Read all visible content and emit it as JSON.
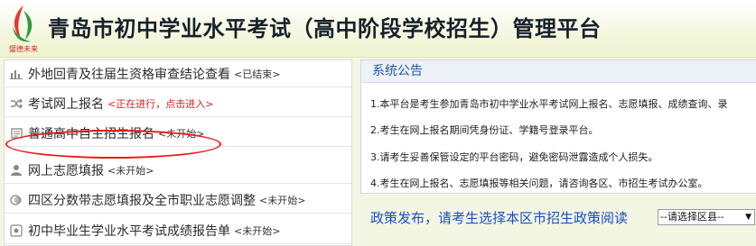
{
  "header": {
    "title": "青岛市初中学业水平考试（高中阶段学校招生）管理平台",
    "logo_text": "璧德未来"
  },
  "menu": [
    {
      "icon": "bar-chart-icon",
      "label": "外地回青及往届生资格审查结论查看",
      "status": "<已结束>",
      "status_color": "#333333"
    },
    {
      "icon": "shuffle-icon",
      "label": "考试网上报名",
      "status": "<正在进行，点击进入>",
      "status_color": "#e02020"
    },
    {
      "icon": "document-icon",
      "label": "普通高中自主招生报名",
      "status": "<未开始>",
      "status_color": "#333333"
    },
    {
      "icon": "user-icon",
      "label": "网上志愿填报",
      "status": "<未开始>",
      "status_color": "#333333"
    },
    {
      "icon": "copy-icon",
      "label": "四区分数带志愿填报及全市职业志愿调整",
      "status": "<未开始>",
      "status_color": "#333333"
    },
    {
      "icon": "report-icon",
      "label": "初中毕业生学业水平考试成绩报告单",
      "status": "<未开始>",
      "status_color": "#333333"
    }
  ],
  "notice": {
    "title": "系统公告",
    "lines": [
      "1.本平台是考生参加青岛市初中学业水平考试网上报名、志愿填报、成绩查询、录",
      "2.考生在网上报名期间凭身份证、学籍号登录平台。",
      "3.请考生妥善保管设定的平台密码，避免密码泄露造成个人损失。",
      "4.考生在网上报名、志愿填报等相关问题，请咨询各区、市招生考试办公室。"
    ]
  },
  "policy": {
    "text": "政策发布，请考生选择本区市招生政策阅读",
    "select_value": "--请选择区县--"
  },
  "colors": {
    "accent_blue": "#2458a6",
    "highlight_red": "#e81c1c",
    "header_bg": "#f4f7df"
  }
}
